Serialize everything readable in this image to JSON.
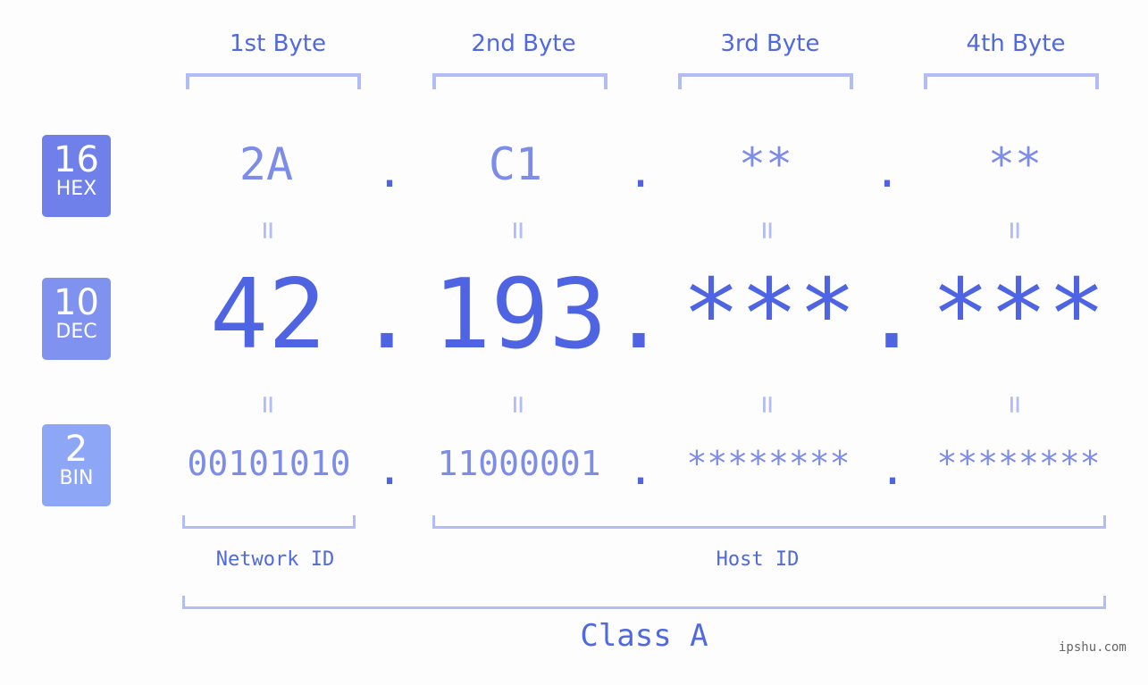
{
  "headers": [
    "1st Byte",
    "2nd Byte",
    "3rd Byte",
    "4th Byte"
  ],
  "badges": [
    {
      "num": "16",
      "label": "HEX",
      "color": "#6f80eb"
    },
    {
      "num": "10",
      "label": "DEC",
      "color": "#8092ef"
    },
    {
      "num": "2",
      "label": "BIN",
      "color": "#8ea6f6"
    }
  ],
  "hex": [
    "2A",
    "C1",
    "**",
    "**"
  ],
  "dec": [
    "42",
    "193",
    "***",
    "***"
  ],
  "bin": [
    "00101010",
    "11000001",
    "********",
    "********"
  ],
  "separator": ".",
  "equals": "=",
  "network_label": "Network ID",
  "host_label": "Host ID",
  "class_label": "Class A",
  "watermark": "ipshu.com"
}
